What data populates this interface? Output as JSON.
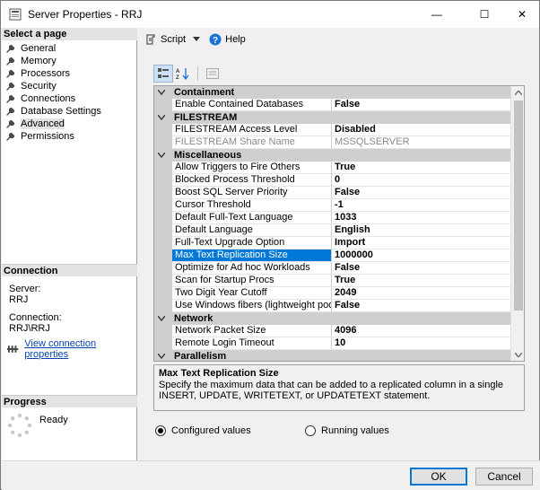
{
  "window": {
    "title": "Server Properties - RRJ",
    "controls": {
      "minimize": "—",
      "maximize": "☐",
      "close": "✕"
    }
  },
  "left": {
    "select_page_header": "Select a page",
    "pages": [
      {
        "label": "General",
        "icon": "wrench-icon"
      },
      {
        "label": "Memory",
        "icon": "wrench-icon"
      },
      {
        "label": "Processors",
        "icon": "wrench-icon"
      },
      {
        "label": "Security",
        "icon": "wrench-icon"
      },
      {
        "label": "Connections",
        "icon": "wrench-icon"
      },
      {
        "label": "Database Settings",
        "icon": "wrench-icon"
      },
      {
        "label": "Advanced",
        "icon": "wrench-icon",
        "selected": true
      },
      {
        "label": "Permissions",
        "icon": "wrench-icon"
      }
    ],
    "connection_header": "Connection",
    "server_label": "Server:",
    "server_value": "RRJ",
    "connection_label": "Connection:",
    "connection_value": "RRJ\\RRJ",
    "view_connection_link": "View connection properties",
    "progress_header": "Progress",
    "progress_status": "Ready"
  },
  "toolbar": {
    "script_label": "Script",
    "help_label": "Help"
  },
  "grid": {
    "categories": [
      {
        "name": "Containment",
        "rows": [
          {
            "name": "Enable Contained Databases",
            "value": "False"
          }
        ]
      },
      {
        "name": "FILESTREAM",
        "rows": [
          {
            "name": "FILESTREAM Access Level",
            "value": "Disabled"
          },
          {
            "name": "FILESTREAM Share Name",
            "value": "MSSQLSERVER",
            "disabled": true
          }
        ]
      },
      {
        "name": "Miscellaneous",
        "rows": [
          {
            "name": "Allow Triggers to Fire Others",
            "value": "True"
          },
          {
            "name": "Blocked Process Threshold",
            "value": "0"
          },
          {
            "name": "Boost SQL Server Priority",
            "value": "False"
          },
          {
            "name": "Cursor Threshold",
            "value": "-1"
          },
          {
            "name": "Default Full-Text Language",
            "value": "1033"
          },
          {
            "name": "Default Language",
            "value": "English"
          },
          {
            "name": "Full-Text Upgrade Option",
            "value": "Import"
          },
          {
            "name": "Max Text Replication Size",
            "value": "1000000",
            "selected": true
          },
          {
            "name": "Optimize for Ad hoc Workloads",
            "value": "False"
          },
          {
            "name": "Scan for Startup Procs",
            "value": "True"
          },
          {
            "name": "Two Digit Year Cutoff",
            "value": "2049"
          },
          {
            "name": "Use Windows fibers (lightweight pooling)",
            "value": "False"
          }
        ]
      },
      {
        "name": "Network",
        "rows": [
          {
            "name": "Network Packet Size",
            "value": "4096"
          },
          {
            "name": "Remote Login Timeout",
            "value": "10"
          }
        ]
      },
      {
        "name": "Parallelism",
        "rows": []
      }
    ]
  },
  "description": {
    "title": "Max Text Replication Size",
    "text": "Specify the maximum data that can be added to a replicated column in a single INSERT, UPDATE, WRITETEXT, or UPDATETEXT statement."
  },
  "view_options": {
    "configured": "Configured values",
    "running": "Running values",
    "selected": "configured"
  },
  "buttons": {
    "ok": "OK",
    "cancel": "Cancel"
  },
  "colors": {
    "selection": "#0078d7",
    "category_bg": "#cfcfcf",
    "link": "#0645ad"
  }
}
